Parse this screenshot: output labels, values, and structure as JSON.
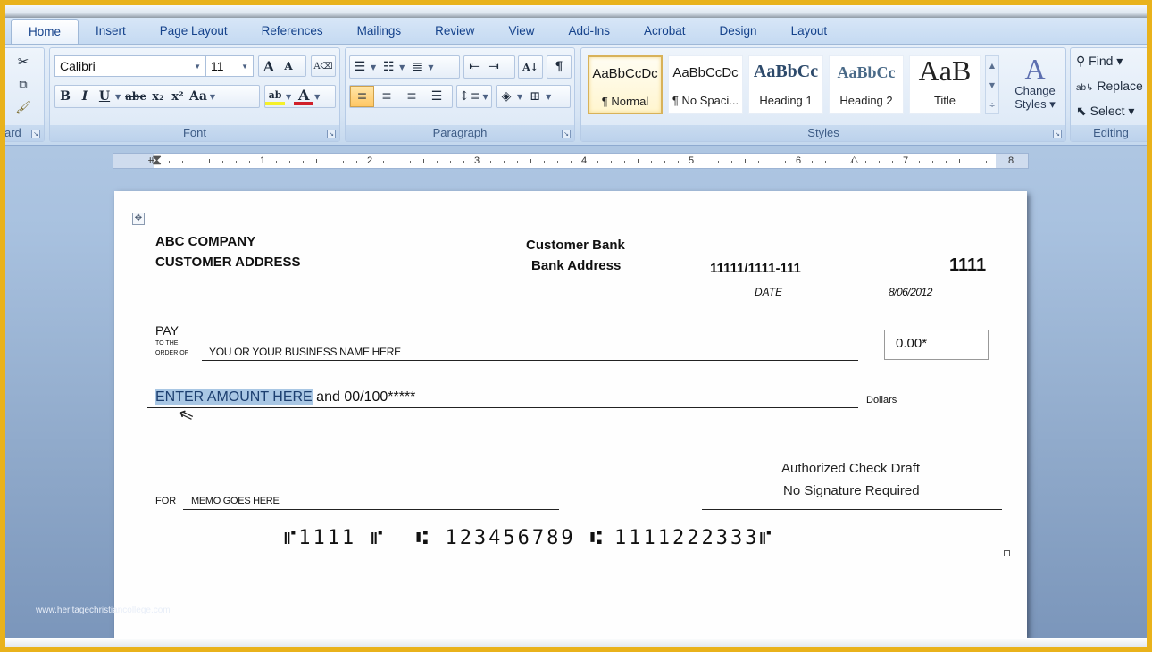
{
  "tabs": [
    "Home",
    "Insert",
    "Page Layout",
    "References",
    "Mailings",
    "Review",
    "View",
    "Add-Ins",
    "Acrobat",
    "Design",
    "Layout"
  ],
  "active_tab": "Home",
  "ribbon": {
    "clipboard": {
      "label": "ard"
    },
    "font": {
      "label": "Font",
      "font_name": "Calibri",
      "font_size": "11",
      "grow_label": "A",
      "shrink_label": "A",
      "bold": "B",
      "italic": "I",
      "underline": "U",
      "strikethrough": "abe",
      "subscript": "x₂",
      "superscript": "x²",
      "change_case": "Aa",
      "highlight": "ab",
      "font_color": "A",
      "highlight_color": "#f5f02a",
      "font_color_swatch": "#d0202a"
    },
    "paragraph": {
      "label": "Paragraph",
      "pilcrow": "¶",
      "sort": "A↓"
    },
    "styles": {
      "label": "Styles",
      "items": [
        {
          "sample": "AaBbCcDc",
          "name": "¶ Normal",
          "selected": true
        },
        {
          "sample": "AaBbCcDc",
          "name": "¶ No Spaci...",
          "selected": false
        },
        {
          "sample": "AaBbCc",
          "name": "Heading 1",
          "selected": false
        },
        {
          "sample": "AaBbCc",
          "name": "Heading 2",
          "selected": false
        },
        {
          "sample": "AaB",
          "name": "Title",
          "selected": false
        }
      ],
      "change_styles": "Change",
      "change_styles_2": "Styles ▾"
    },
    "editing": {
      "label": "Editing",
      "find": "Find ▾",
      "replace": "Replace",
      "select": "Select ▾"
    }
  },
  "ruler": {
    "numbers": [
      "1",
      "2",
      "3",
      "4",
      "5",
      "6",
      "7",
      "8"
    ]
  },
  "check": {
    "company": "ABC COMPANY",
    "company_address": "CUSTOMER ADDRESS",
    "bank": "Customer Bank",
    "bank_address": "Bank Address",
    "routing": "11111/1111-111",
    "check_number": "1111",
    "date_label": "DATE",
    "date": "8/06/2012",
    "pay_label": "PAY",
    "to_the": "TO THE",
    "order_of": "ORDER OF",
    "payee": "YOU OR YOUR BUSINESS NAME HERE",
    "amount_box": "0.00*",
    "amount_words_selected": "ENTER AMOUNT HERE",
    "amount_words_rest": " and 00/100*****",
    "dollars_label": "Dollars",
    "signature_line1": "Authorized Check Draft",
    "signature_line2": "No Signature Required",
    "for_label": "FOR",
    "memo": "MEMO GOES HERE",
    "micr_check": "⑈1111 ⑈",
    "micr_routing": "⑆ 123456789 ⑆",
    "micr_account": "1111222333⑈"
  },
  "watermark": "www.heritagechristiancollege.com"
}
